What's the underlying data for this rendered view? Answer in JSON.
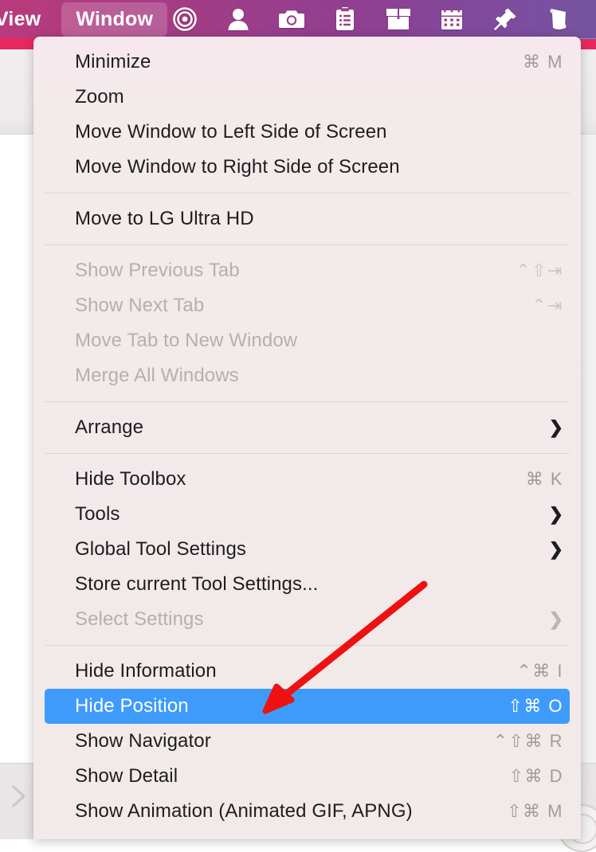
{
  "menubar": {
    "titles": [
      {
        "label": "View",
        "active": false,
        "clipped": true
      },
      {
        "label": "Window",
        "active": true,
        "clipped": false
      }
    ],
    "icons": [
      {
        "name": "target-icon"
      },
      {
        "name": "contact-person-icon"
      },
      {
        "name": "camera-icon"
      },
      {
        "name": "clipboard-icon"
      },
      {
        "name": "box-package-icon"
      },
      {
        "name": "calendar-icon"
      },
      {
        "name": "pushpin-icon"
      },
      {
        "name": "note-scroll-icon"
      }
    ],
    "colors": {
      "gradient_start": "#b83b7c",
      "gradient_end": "#76539f",
      "underline_pink": "#e8275f",
      "underline_blue": "#4ca7d8",
      "active_item_text": "#ffffff"
    }
  },
  "menu": {
    "name": "window-menu",
    "highlight_color": "#3e9bfb",
    "background_color": "#f3eaea",
    "groups": [
      {
        "items": [
          {
            "label": "Minimize",
            "shortcut": "⌘ M",
            "disabled": false,
            "submenu": false
          },
          {
            "label": "Zoom",
            "shortcut": "",
            "disabled": false,
            "submenu": false
          },
          {
            "label": "Move Window to Left Side of Screen",
            "shortcut": "",
            "disabled": false,
            "submenu": false
          },
          {
            "label": "Move Window to Right Side of Screen",
            "shortcut": "",
            "disabled": false,
            "submenu": false
          }
        ]
      },
      {
        "items": [
          {
            "label": "Move to LG Ultra HD",
            "shortcut": "",
            "disabled": false,
            "submenu": false
          }
        ]
      },
      {
        "items": [
          {
            "label": "Show Previous Tab",
            "shortcut": "⌃⇧⇥",
            "disabled": true,
            "submenu": false
          },
          {
            "label": "Show Next Tab",
            "shortcut": "⌃⇥",
            "disabled": true,
            "submenu": false
          },
          {
            "label": "Move Tab to New Window",
            "shortcut": "",
            "disabled": true,
            "submenu": false
          },
          {
            "label": "Merge All Windows",
            "shortcut": "",
            "disabled": true,
            "submenu": false
          }
        ]
      },
      {
        "items": [
          {
            "label": "Arrange",
            "shortcut": "",
            "disabled": false,
            "submenu": true
          }
        ]
      },
      {
        "items": [
          {
            "label": "Hide Toolbox",
            "shortcut": "⌘ K",
            "disabled": false,
            "submenu": false
          },
          {
            "label": "Tools",
            "shortcut": "",
            "disabled": false,
            "submenu": true
          },
          {
            "label": "Global Tool Settings",
            "shortcut": "",
            "disabled": false,
            "submenu": true
          },
          {
            "label": "Store current Tool Settings...",
            "shortcut": "",
            "disabled": false,
            "submenu": false
          },
          {
            "label": "Select Settings",
            "shortcut": "",
            "disabled": true,
            "submenu": true
          }
        ]
      },
      {
        "items": [
          {
            "label": "Hide Information",
            "shortcut": "⌃⌘ I",
            "disabled": false,
            "submenu": false
          },
          {
            "label": "Hide Position",
            "shortcut": "⇧⌘ O",
            "disabled": false,
            "submenu": false,
            "selected": true
          },
          {
            "label": "Show Navigator",
            "shortcut": "⌃⇧⌘ R",
            "disabled": false,
            "submenu": false
          },
          {
            "label": "Show Detail",
            "shortcut": "⇧⌘ D",
            "disabled": false,
            "submenu": false
          },
          {
            "label": "Show Animation (Animated GIF, APNG)",
            "shortcut": "⇧⌘ M",
            "disabled": false,
            "submenu": false
          }
        ]
      }
    ]
  },
  "annotation": {
    "name": "red-arrow-annotation",
    "color": "#ee1111",
    "points_to": "Hide Position"
  },
  "background": {
    "expand_chevron": "chevron-right-icon"
  }
}
